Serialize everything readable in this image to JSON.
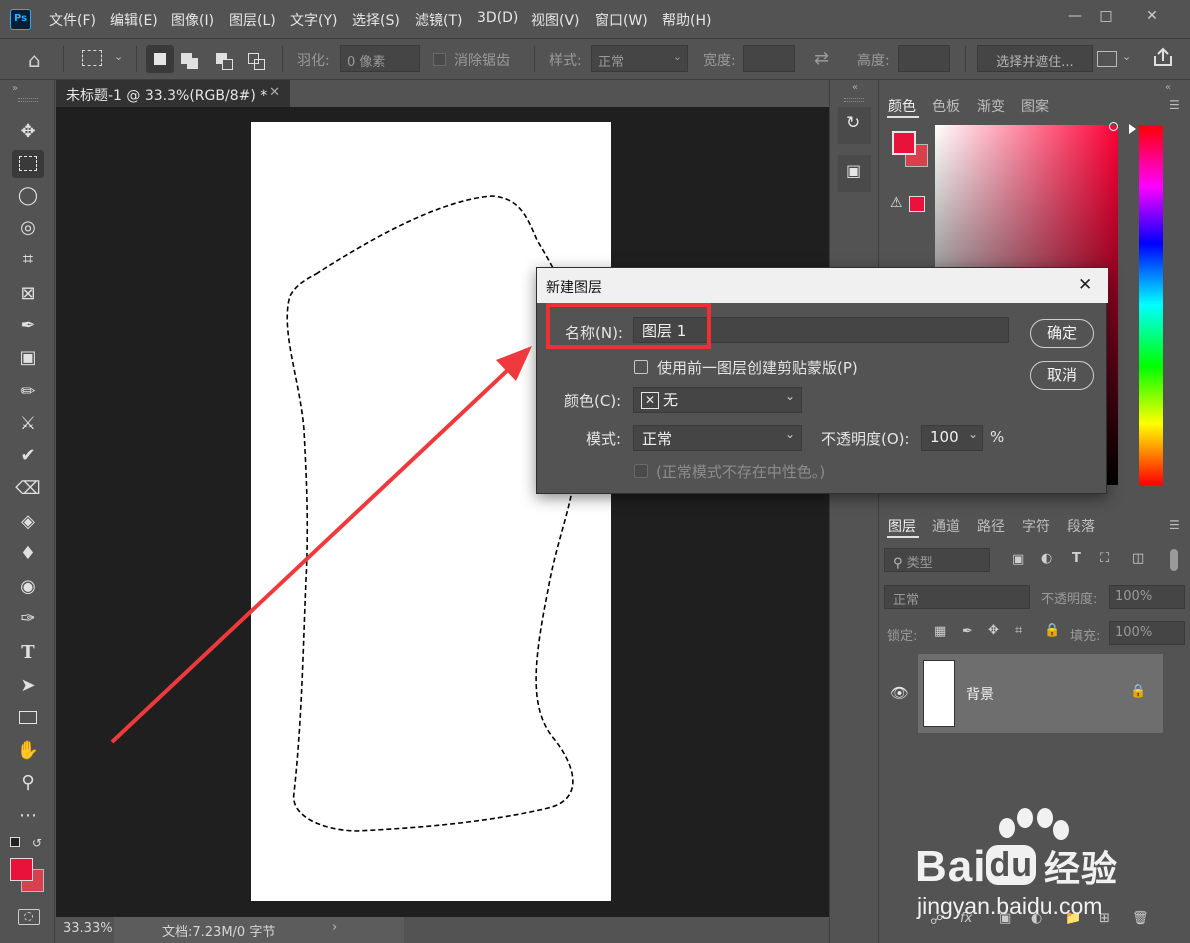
{
  "app": {
    "logo": "Ps"
  },
  "menu": [
    "文件(F)",
    "编辑(E)",
    "图像(I)",
    "图层(L)",
    "文字(Y)",
    "选择(S)",
    "滤镜(T)",
    "3D(D)",
    "视图(V)",
    "窗口(W)",
    "帮助(H)"
  ],
  "options": {
    "feather_label": "羽化:",
    "feather_value": "0 像素",
    "antialias_label": "消除锯齿",
    "style_label": "样式:",
    "style_value": "正常",
    "width_label": "宽度:",
    "height_label": "高度:",
    "select_mask_label": "选择并遮住..."
  },
  "document": {
    "tab_title": "未标题-1 @ 33.3%(RGB/8#) *",
    "zoom": "33.33%",
    "doc_info": "文档:7.23M/0 字节"
  },
  "color_panel": {
    "tabs": [
      "颜色",
      "色板",
      "渐变",
      "图案"
    ],
    "foreground": "#e8123a",
    "background": "#d9404d"
  },
  "layers_panel": {
    "tabs": [
      "图层",
      "通道",
      "路径",
      "字符",
      "段落"
    ],
    "filter_label": "类型",
    "blend_mode": "正常",
    "opacity_label": "不透明度:",
    "opacity_value": "100%",
    "lock_label": "锁定:",
    "fill_label": "填充:",
    "fill_value": "100%",
    "layers": [
      {
        "name": "背景"
      }
    ]
  },
  "dialog": {
    "title": "新建图层",
    "name_label": "名称(N):",
    "name_value": "图层 1",
    "clip_label": "使用前一图层创建剪贴蒙版(P)",
    "color_label": "颜色(C):",
    "color_value": "无",
    "mode_label": "模式:",
    "mode_value": "正常",
    "opacity_label": "不透明度(O):",
    "opacity_value": "100",
    "opacity_unit": "%",
    "neutral_label": "(正常模式不存在中性色。)",
    "ok_label": "确定",
    "cancel_label": "取消"
  },
  "watermark": {
    "brand_a": "Bai",
    "brand_b": "du",
    "brand_cn": "经验",
    "url": "jingyan.baidu.com"
  }
}
